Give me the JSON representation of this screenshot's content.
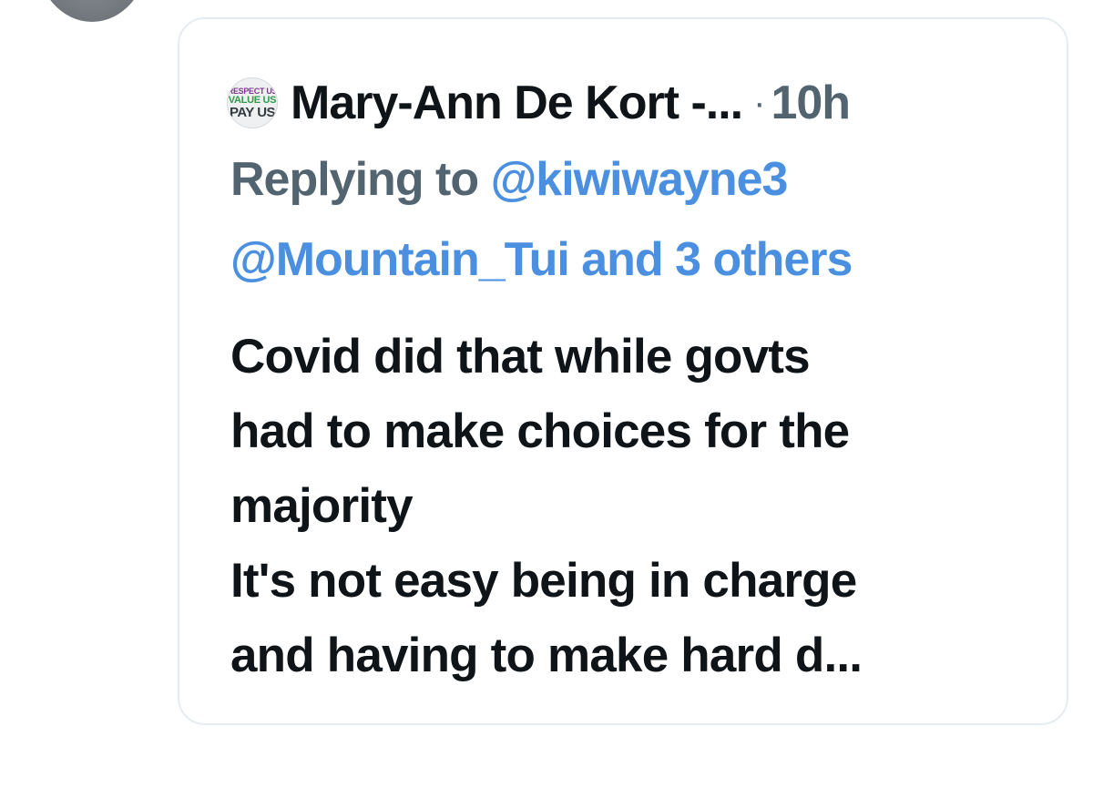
{
  "quoted_tweet": {
    "author_name": "Mary-Ann De Kort -...",
    "separator": "·",
    "time": "10h",
    "avatar_badge": {
      "line1": "RESPECT US",
      "line2": "VALUE US",
      "line3": "PAY US"
    },
    "reply": {
      "prefix": "Replying to",
      "mention1": "@kiwiwayne3",
      "mention2": "@Mountain_Tui",
      "others": "and 3 others"
    },
    "body_lines": [
      "Covid did that while govts",
      "had to make choices for the",
      "majority",
      "It's not easy being in charge",
      "and having to make hard d..."
    ]
  },
  "colors": {
    "text_primary": "#0f1419",
    "text_muted": "#536471",
    "link": "#4a8fe0",
    "card_border": "#e6ecf0"
  }
}
